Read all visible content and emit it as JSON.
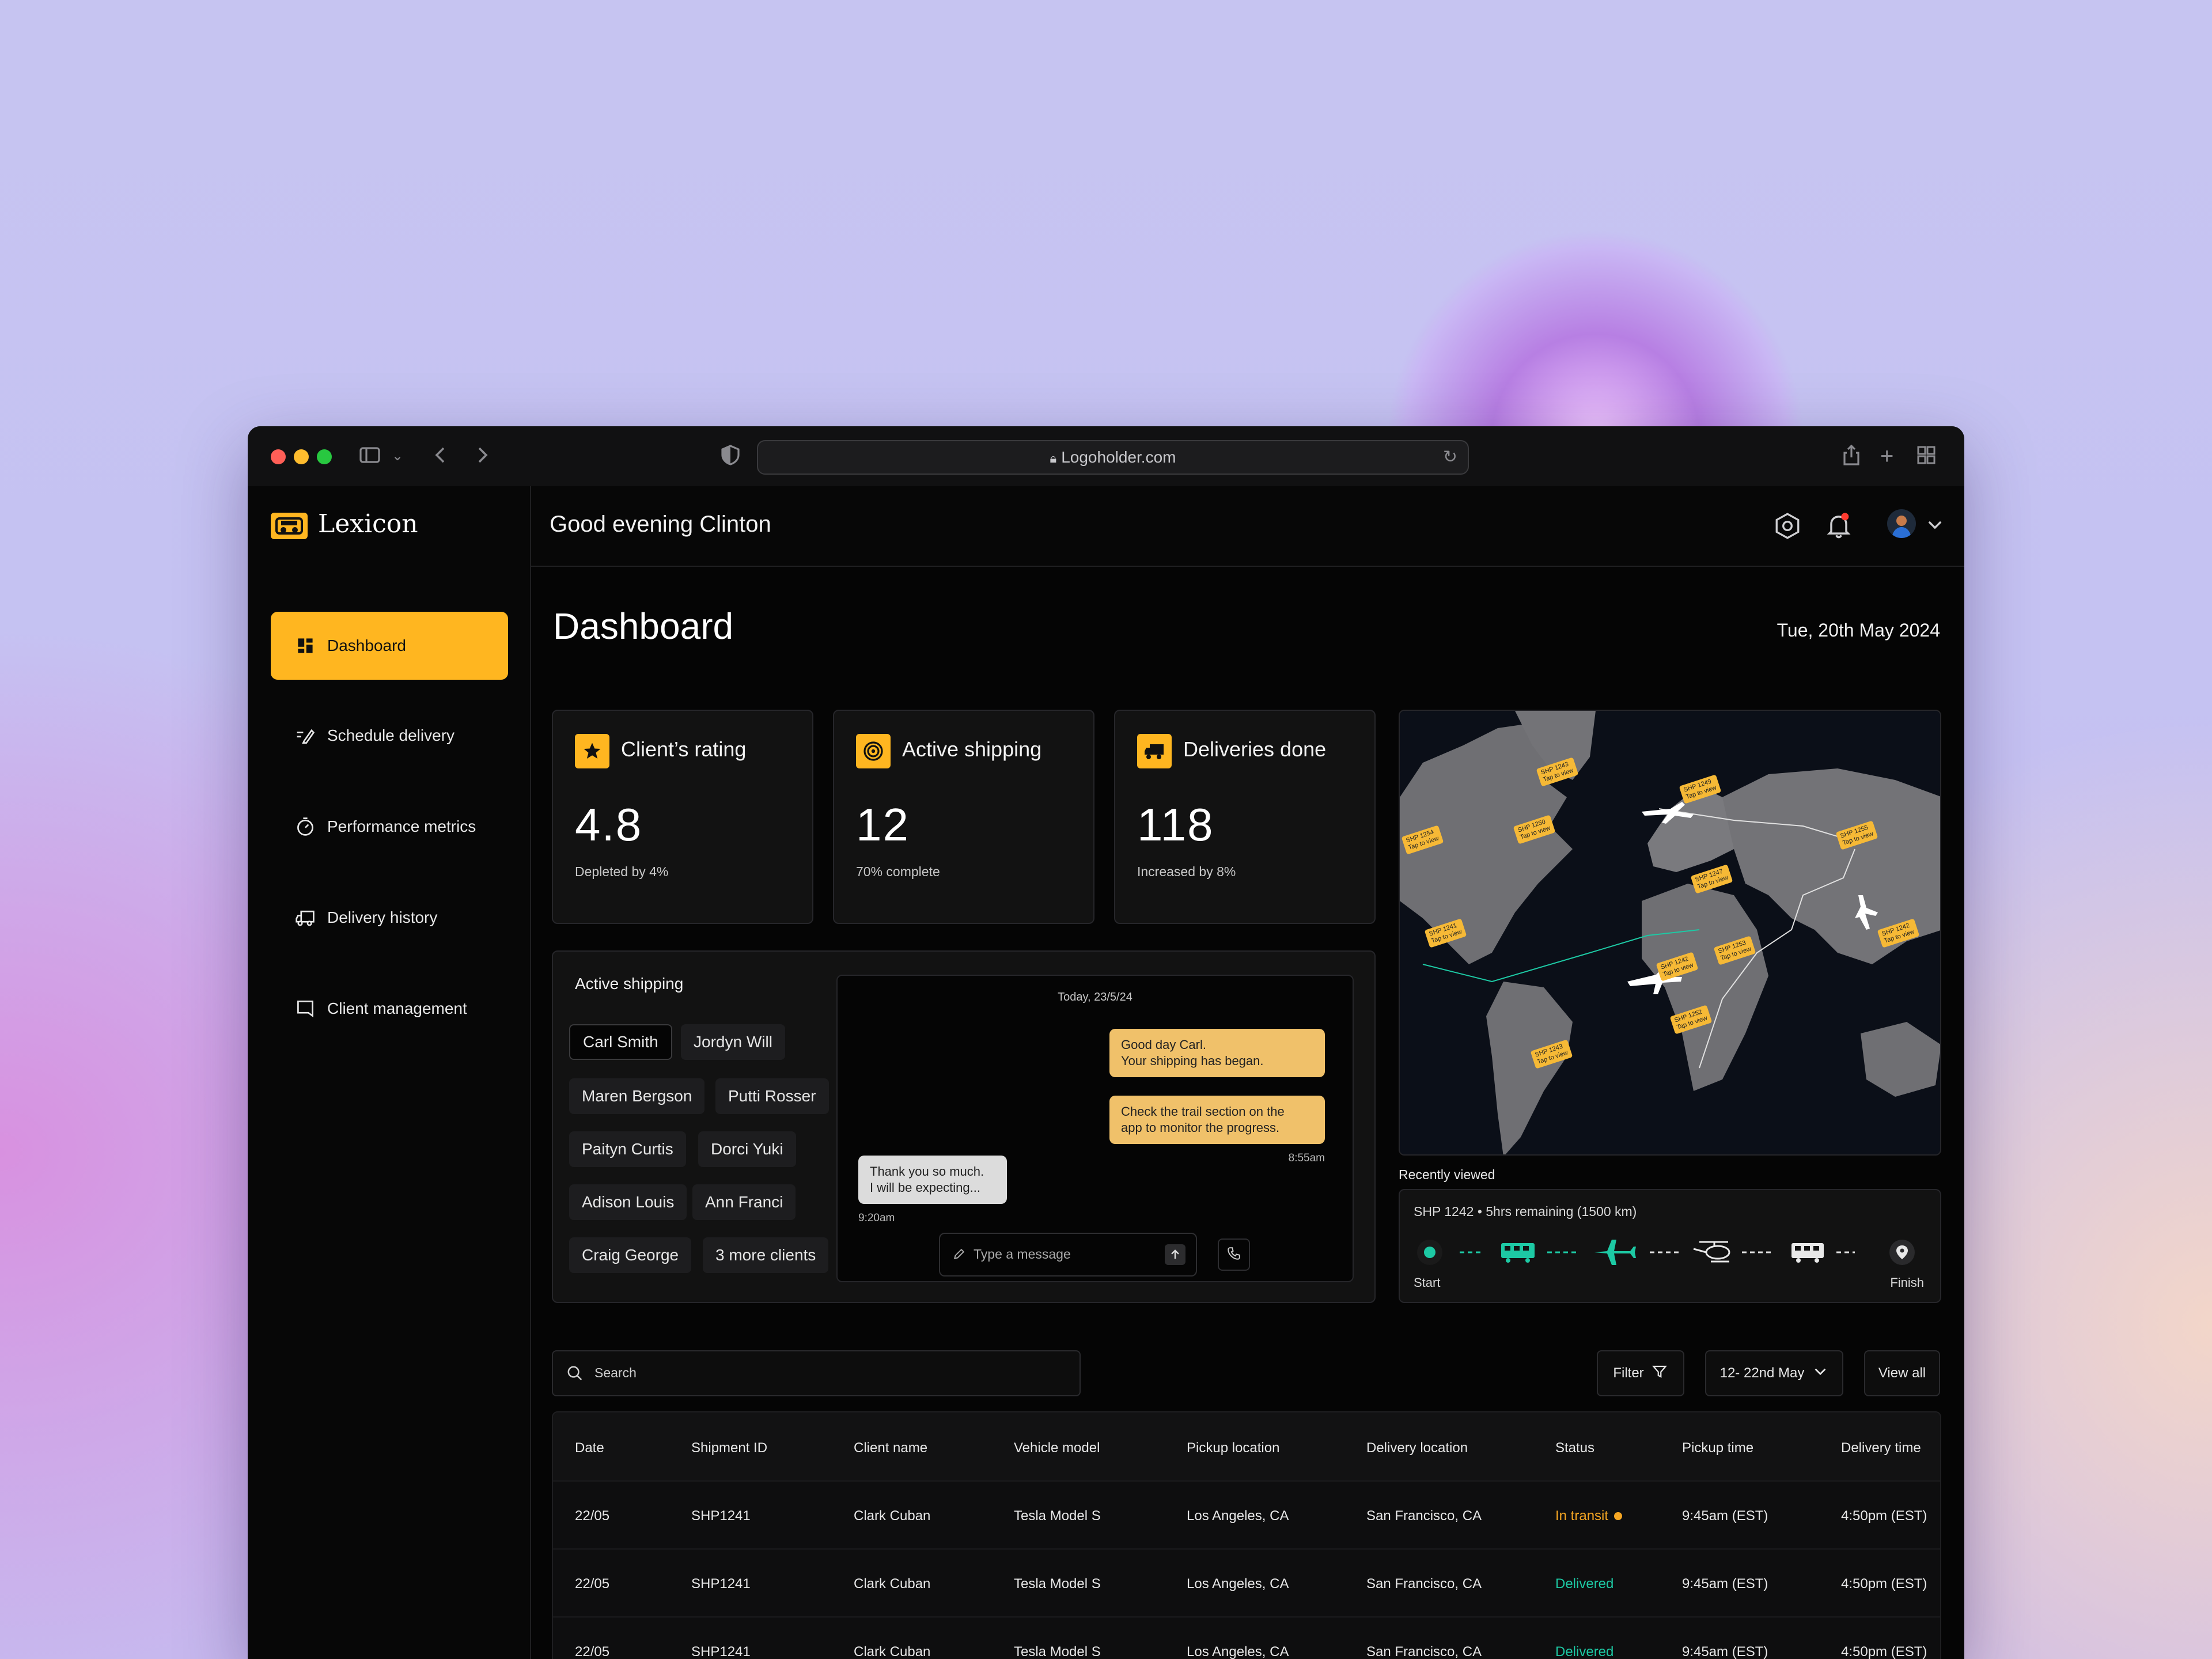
{
  "browser": {
    "url": "Logoholder.com"
  },
  "app": {
    "name": "Lexicon",
    "greeting": "Good evening Clinton"
  },
  "sidebar": {
    "items": [
      {
        "label": "Dashboard",
        "icon": "dashboard-icon",
        "active": true
      },
      {
        "label": "Schedule delivery",
        "icon": "schedule-icon",
        "active": false
      },
      {
        "label": "Performance metrics",
        "icon": "metrics-icon",
        "active": false
      },
      {
        "label": "Delivery history",
        "icon": "truck-icon",
        "active": false
      },
      {
        "label": "Client management",
        "icon": "client-icon",
        "active": false
      }
    ]
  },
  "page": {
    "title": "Dashboard",
    "date": "Tue, 20th May 2024"
  },
  "stats": [
    {
      "title": "Client’s rating",
      "value": "4.8",
      "sub": "Depleted by 4%",
      "icon": "star-icon"
    },
    {
      "title": "Active shipping",
      "value": "12",
      "sub": "70% complete",
      "icon": "radar-icon"
    },
    {
      "title": "Deliveries done",
      "value": "118",
      "sub": "Increased by 8%",
      "icon": "truck-icon"
    }
  ],
  "active_shipping": {
    "title": "Active shipping",
    "clients": [
      "Carl Smith",
      "Jordyn Will",
      "Maren Bergson",
      "Putti Rosser",
      "Paityn Curtis",
      "Dorci Yuki",
      "Adison Louis",
      "Ann Franci",
      "Craig George",
      "3 more clients"
    ]
  },
  "chat": {
    "date": "Today, 23/5/24",
    "msg1_line1": "Good day Carl.",
    "msg1_line2": "Your shipping has began.",
    "msg2_line1": "Check the trail section on the",
    "msg2_line2": "app to monitor the progress.",
    "sent_time": "8:55am",
    "reply_line1": "Thank you so much.",
    "reply_line2": "I will be expecting...",
    "reply_time": "9:20am",
    "placeholder": "Type a message"
  },
  "map": {
    "pins": [
      {
        "id": "SHP 1243",
        "tap": "Tap to view"
      },
      {
        "id": "SHP 1249",
        "tap": "Tap to view"
      },
      {
        "id": "SHP 1250",
        "tap": "Tap to view"
      },
      {
        "id": "SHP 1254",
        "tap": "Tap to view"
      },
      {
        "id": "SHP 1255",
        "tap": "Tap to view"
      },
      {
        "id": "SHP 1247",
        "tap": "Tap to view"
      },
      {
        "id": "SHP 1241",
        "tap": "Tap to view"
      },
      {
        "id": "SHP 1253",
        "tap": "Tap to view"
      },
      {
        "id": "SHP 1242",
        "tap": "Tap to view"
      },
      {
        "id": "SHP 1242",
        "tap": "Tap to view"
      },
      {
        "id": "SHP 1252",
        "tap": "Tap to view"
      },
      {
        "id": "SHP 1243",
        "tap": "Tap to view"
      }
    ]
  },
  "recent": {
    "label": "Recently viewed",
    "summary": "SHP 1242 • 5hrs remaining (1500 km)",
    "start": "Start",
    "finish": "Finish",
    "accent": "#1dc9a4"
  },
  "toolbar": {
    "search_placeholder": "Search",
    "filter": "Filter",
    "range": "12- 22nd May",
    "view_all": "View all"
  },
  "table": {
    "headers": [
      "Date",
      "Shipment ID",
      "Client name",
      "Vehicle model",
      "Pickup location",
      "Delivery location",
      "Status",
      "Pickup time",
      "Delivery time"
    ],
    "rows": [
      [
        "22/05",
        "SHP1241",
        "Clark Cuban",
        "Tesla Model S",
        "Los Angeles, CA",
        "San Francisco, CA",
        "In transit",
        "9:45am (EST)",
        "4:50pm (EST)"
      ],
      [
        "22/05",
        "SHP1241",
        "Clark Cuban",
        "Tesla Model S",
        "Los Angeles, CA",
        "San Francisco, CA",
        "Delivered",
        "9:45am (EST)",
        "4:50pm (EST)"
      ],
      [
        "22/05",
        "SHP1241",
        "Clark Cuban",
        "Tesla Model S",
        "Los Angeles, CA",
        "San Francisco, CA",
        "Delivered",
        "9:45am (EST)",
        "4:50pm (EST)"
      ]
    ]
  },
  "colors": {
    "brand": "#ffb620",
    "in_transit": "#f5a623",
    "delivered": "#1dc9a4"
  }
}
